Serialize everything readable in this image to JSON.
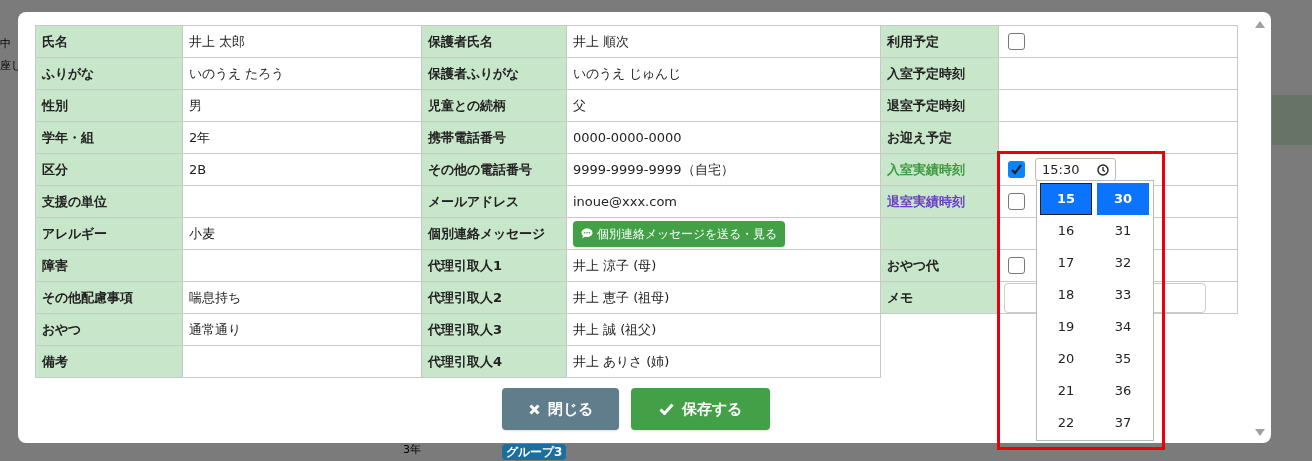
{
  "background": {
    "texts": [
      "中",
      "座し",
      "3年"
    ],
    "badge": "グループ3"
  },
  "child_info": [
    {
      "label": "氏名",
      "value": "井上 太郎"
    },
    {
      "label": "ふりがな",
      "value": "いのうえ たろう"
    },
    {
      "label": "性別",
      "value": "男"
    },
    {
      "label": "学年・組",
      "value": "2年"
    },
    {
      "label": "区分",
      "value": "2B"
    },
    {
      "label": "支援の単位"
    },
    {
      "label": "アレルギー",
      "value": "小麦"
    },
    {
      "label": "障害"
    },
    {
      "label": "その他配慮事項",
      "value": "喘息持ち"
    },
    {
      "label": "おやつ",
      "value": "通常通り"
    },
    {
      "label": "備考"
    }
  ],
  "guardian_info": [
    {
      "label": "保護者氏名",
      "kind": "text",
      "value": "井上 順次"
    },
    {
      "label": "保護者ふりがな",
      "kind": "text",
      "value": "いのうえ じゅんじ"
    },
    {
      "label": "児童との続柄",
      "kind": "text",
      "value": "父"
    },
    {
      "label": "携帯電話番号",
      "kind": "text",
      "value": "0000-0000-0000"
    },
    {
      "label": "その他の電話番号",
      "kind": "text",
      "value": "9999-9999-9999（自宅）"
    },
    {
      "label": "メールアドレス",
      "kind": "text",
      "value": "inoue@xxx.com"
    },
    {
      "label": "個別連絡メッセージ",
      "kind": "button",
      "value": "個別連絡メッセージを送る・見る"
    },
    {
      "label": "代理引取人1",
      "kind": "text",
      "value": "井上 涼子 (母)"
    },
    {
      "label": "代理引取人2",
      "kind": "text",
      "value": "井上 恵子 (祖母)"
    },
    {
      "label": "代理引取人3",
      "kind": "text",
      "value": "井上 誠 (祖父)"
    },
    {
      "label": "代理引取人4",
      "kind": "text",
      "value": "井上 ありさ (姉)"
    }
  ],
  "attendance": [
    {
      "label": "利用予定",
      "kind": "checkbox",
      "checked": false
    },
    {
      "label": "入室予定時刻",
      "kind": "empty"
    },
    {
      "label": "退室予定時刻",
      "kind": "empty"
    },
    {
      "label": "お迎え予定",
      "kind": "empty"
    },
    {
      "label": "入室実績時刻",
      "kind": "time",
      "color": "#3d9a40",
      "checked": true,
      "value": "15:30"
    },
    {
      "label": "退室実績時刻",
      "kind": "checkbox",
      "color": "#6a3fc4",
      "checked": false
    },
    {
      "kind": "empty"
    },
    {
      "label": "おやつ代",
      "kind": "checkbox",
      "checked": false
    },
    {
      "label": "メモ",
      "kind": "memo"
    }
  ],
  "time_picker": {
    "hours": [
      {
        "label": "15",
        "selected": true
      },
      {
        "label": "16",
        "selected": false
      },
      {
        "label": "17",
        "selected": false
      },
      {
        "label": "18",
        "selected": false
      },
      {
        "label": "19",
        "selected": false
      },
      {
        "label": "20",
        "selected": false
      },
      {
        "label": "21",
        "selected": false
      },
      {
        "label": "22",
        "selected": false
      }
    ],
    "minutes": [
      {
        "label": "30",
        "selected": true
      },
      {
        "label": "31",
        "selected": false
      },
      {
        "label": "32",
        "selected": false
      },
      {
        "label": "33",
        "selected": false
      },
      {
        "label": "34",
        "selected": false
      },
      {
        "label": "35",
        "selected": false
      },
      {
        "label": "36",
        "selected": false
      },
      {
        "label": "37",
        "selected": false
      }
    ]
  },
  "buttons": [
    {
      "kind": "close",
      "label": "閉じる"
    },
    {
      "kind": "save",
      "label": "保存する"
    }
  ]
}
